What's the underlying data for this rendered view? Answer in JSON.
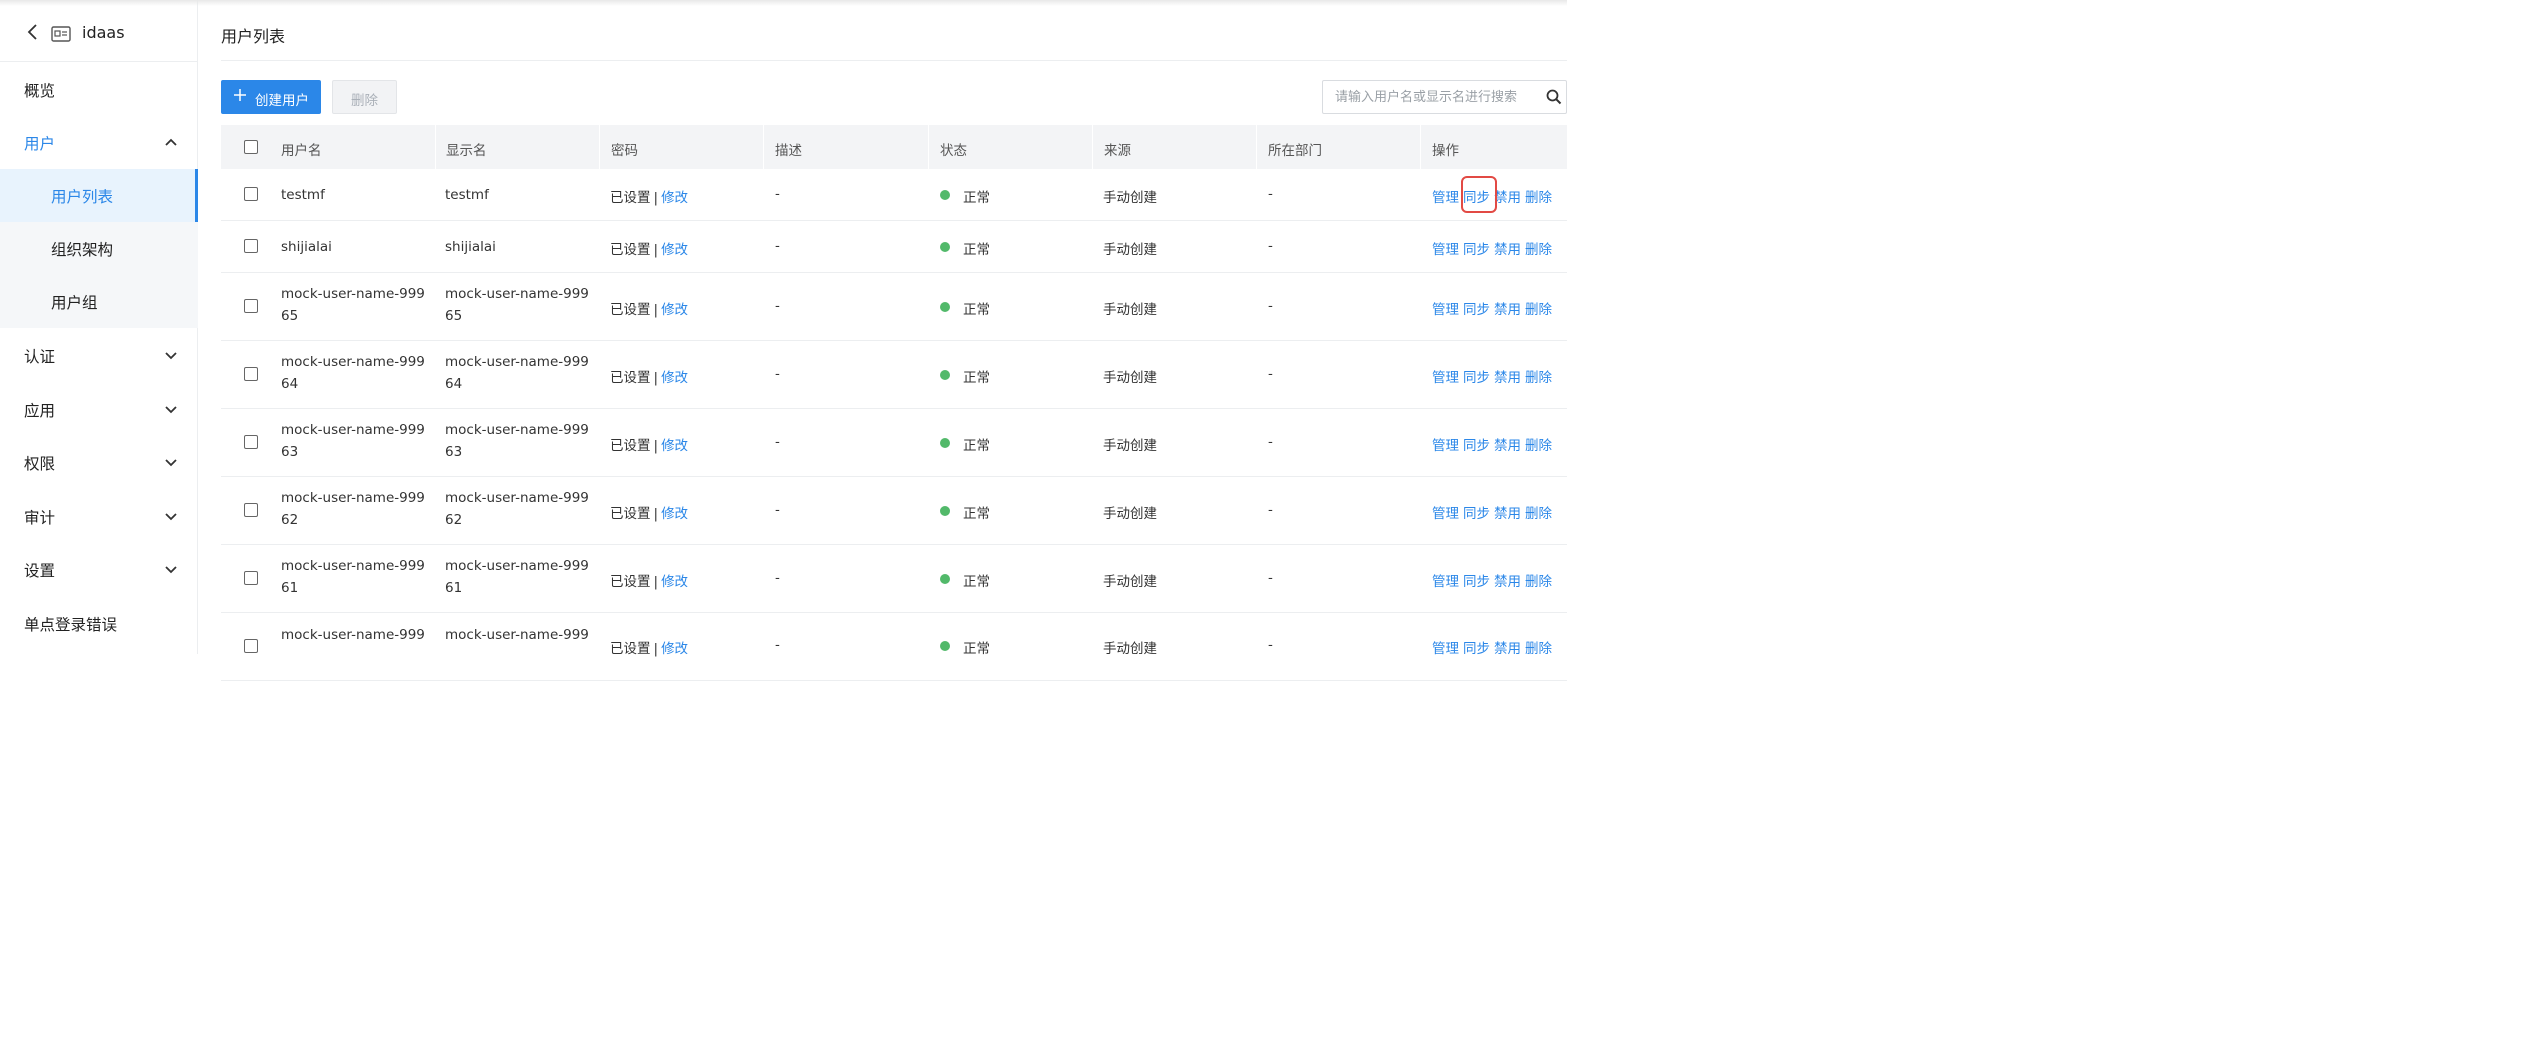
{
  "app": {
    "title": "idaas"
  },
  "sidebar": {
    "items": [
      {
        "label": "概览"
      },
      {
        "label": "用户"
      },
      {
        "label": "认证"
      },
      {
        "label": "应用"
      },
      {
        "label": "权限"
      },
      {
        "label": "审计"
      },
      {
        "label": "设置"
      },
      {
        "label": "单点登录错误"
      }
    ],
    "sub_items": [
      {
        "label": "用户列表"
      },
      {
        "label": "组织架构"
      },
      {
        "label": "用户组"
      }
    ]
  },
  "main": {
    "title": "用户列表",
    "toolbar": {
      "create_label": "创建用户",
      "delete_label": "删除"
    },
    "search": {
      "placeholder": "请输入用户名或显示名进行搜索"
    },
    "columns": [
      "用户名",
      "显示名",
      "密码",
      "描述",
      "状态",
      "来源",
      "所在部门",
      "操作"
    ],
    "rows": [
      {
        "username": [
          "testmf"
        ],
        "display": [
          "testmf"
        ]
      },
      {
        "username": [
          "shijialai"
        ],
        "display": [
          "shijialai"
        ]
      },
      {
        "username": [
          "mock-user-name-999",
          "65"
        ],
        "display": [
          "mock-user-name-999",
          "65"
        ]
      },
      {
        "username": [
          "mock-user-name-999",
          "64"
        ],
        "display": [
          "mock-user-name-999",
          "64"
        ]
      },
      {
        "username": [
          "mock-user-name-999",
          "63"
        ],
        "display": [
          "mock-user-name-999",
          "63"
        ]
      },
      {
        "username": [
          "mock-user-name-999",
          "62"
        ],
        "display": [
          "mock-user-name-999",
          "62"
        ]
      },
      {
        "username": [
          "mock-user-name-999",
          "61"
        ],
        "display": [
          "mock-user-name-999",
          "61"
        ]
      },
      {
        "username": [
          "mock-user-name-999"
        ],
        "display": [
          "mock-user-name-999"
        ]
      }
    ],
    "password_status": "已设置",
    "password_edit": "修改",
    "desc_value": "-",
    "status_text": "正常",
    "source_text": "手动创建",
    "dept_value": "-",
    "actions": {
      "manage": "管理",
      "sync": "同步",
      "disable": "禁用",
      "delete": "删除"
    },
    "status_color": "#52b96a",
    "accent_color": "#2b87e8",
    "highlight_color": "#e24a44"
  }
}
